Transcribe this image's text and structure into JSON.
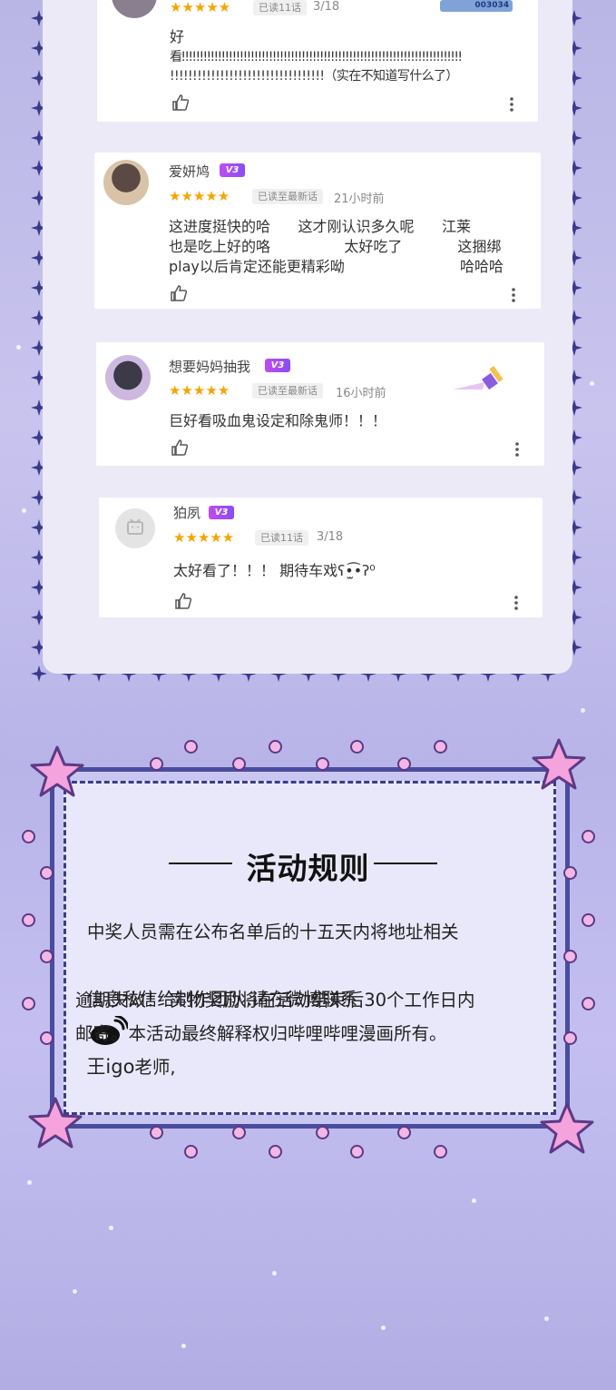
{
  "comments": [
    {
      "username": "",
      "stars": "★★★★★",
      "read_chip": "已读11话",
      "date": "3/18",
      "text_lines": [
        "好",
        "看!!!!!!!!!!!!!!!!!!!!!!!!!!!!!!!!!!!!!!!!!!!!!!!!!!!!!!!!!!!!!!!!!!!!!!!!!!!!!",
        "!!!!!!!!!!!!!!!!!!!!!!!!!!!!!!!!!!（实在不知道写什么了）"
      ],
      "badge_text": "003034"
    },
    {
      "username": "爱妍鸠",
      "vip": "V3",
      "stars": "★★★★★",
      "read_chip": "已读至最新话",
      "date": "21小时前",
      "text_lines": [
        "这进度挺快的哈      这才刚认识多久呢      江莱",
        "也是吃上好的咯                太好吃了            这捆绑",
        "play以后肯定还能更精彩呦                         哈哈哈"
      ]
    },
    {
      "username": "想要妈妈抽我",
      "vip": "V3",
      "stars": "★★★★★",
      "read_chip": "已读至最新话",
      "date": "16小时前",
      "text_lines": [
        "巨好看吸血鬼设定和除鬼师！！！"
      ]
    },
    {
      "username": "狛夙",
      "vip": "V3",
      "stars": "★★★★★",
      "read_chip": "已读11话",
      "date": "3/18",
      "text_lines": [
        "太好看了！！！ 期待车戏ʕ•̫͡•ʔ⁰"
      ]
    }
  ],
  "rules": {
    "title": "活动规则",
    "line1": "中奖人员需在公布名单后的十五天内将地址相关",
    "line2_prefix": "信息私信给制作团队,请在微博联系",
    "weibo_name": "王igo",
    "line2_suffix": "老师,",
    "line3": "逾期失效！ 实物奖励将在活动结束后30个工作日内",
    "line4": "邮寄。本活动最终解释权归哔哩哔哩漫画所有。"
  },
  "colors": {
    "star": "#f6a400",
    "vip": "#a04cf2",
    "frame": "#4a4c9e",
    "corner_star": "#f5a3dc"
  },
  "icons": [
    "like-icon",
    "more-icon",
    "weibo-icon",
    "default-avatar-icon",
    "brush-sticker-icon"
  ]
}
